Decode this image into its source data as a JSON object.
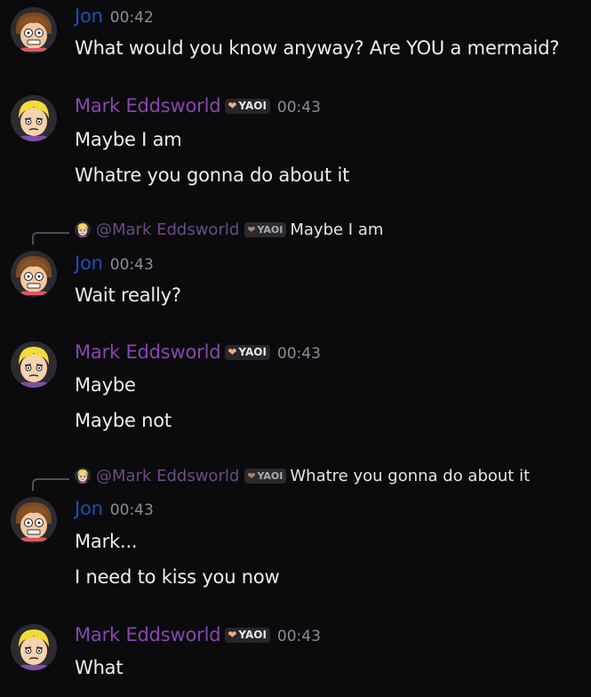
{
  "colors": {
    "jon": "#1d4fb8",
    "mark": "#8a46b0",
    "timestamp": "#8b8e95",
    "background": "#0b0b0d"
  },
  "tag": {
    "icon": "heart-icon",
    "label": "YAOI"
  },
  "messages": [
    {
      "author": "Jon",
      "time": "00:42",
      "lines": [
        "What would you know anyway? Are YOU a mermaid?"
      ]
    },
    {
      "author": "Mark Eddsworld",
      "time": "00:43",
      "lines": [
        "Maybe I am",
        "Whatre you gonna do about it"
      ]
    },
    {
      "reply": {
        "author": "@Mark Eddsworld",
        "text": "Maybe I am"
      },
      "author": "Jon",
      "time": "00:43",
      "lines": [
        "Wait really?"
      ]
    },
    {
      "author": "Mark Eddsworld",
      "time": "00:43",
      "lines": [
        "Maybe",
        "Maybe not"
      ]
    },
    {
      "reply": {
        "author": "@Mark Eddsworld",
        "text": "Whatre you gonna do about it"
      },
      "author": "Jon",
      "time": "00:43",
      "lines": [
        "Mark...",
        "I need to kiss you now"
      ]
    },
    {
      "author": "Mark Eddsworld",
      "time": "00:43",
      "lines": [
        "What"
      ]
    }
  ]
}
